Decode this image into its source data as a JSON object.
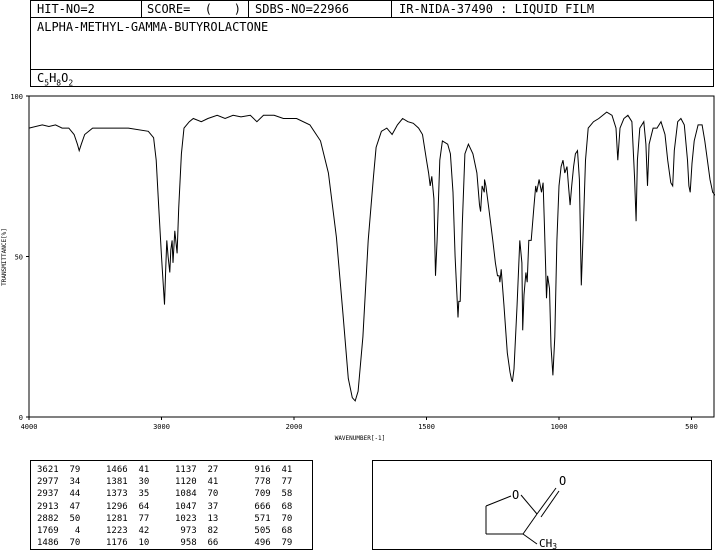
{
  "header": {
    "hit_no": "HIT-NO=2",
    "score": "SCORE=  (   )",
    "sdbs_no": "SDBS-NO=22966",
    "ir_info": "IR-NIDA-37490 : LIQUID FILM",
    "compound_name": "ALPHA-METHYL-GAMMA-BUTYROLACTONE",
    "formula": {
      "c": "C",
      "c_n": "5",
      "h": "H",
      "h_n": "8",
      "o": "O",
      "o_n": "2"
    }
  },
  "chart_data": {
    "type": "line",
    "xlabel": "WAVENUMBER[-1]",
    "ylabel": "TRANSMITTANCE[%]",
    "xlim": [
      4000,
      400
    ],
    "ylim": [
      0,
      100
    ],
    "x_ticks": [
      4000,
      3000,
      2000,
      1500,
      1000,
      500
    ],
    "x_tick_labels": [
      "4000",
      "3000",
      "2000",
      "1500",
      "1000",
      "500"
    ],
    "y_ticks": [
      0,
      50,
      100
    ],
    "y_tick_labels": [
      "0",
      "50",
      "100"
    ],
    "grid": false,
    "series": [
      {
        "points": [
          [
            4000,
            90
          ],
          [
            3900,
            91
          ],
          [
            3850,
            90.5
          ],
          [
            3800,
            91
          ],
          [
            3750,
            90
          ],
          [
            3700,
            90
          ],
          [
            3660,
            88
          ],
          [
            3635,
            85
          ],
          [
            3621,
            83
          ],
          [
            3605,
            85
          ],
          [
            3580,
            88
          ],
          [
            3520,
            90
          ],
          [
            3400,
            90
          ],
          [
            3250,
            90
          ],
          [
            3100,
            89
          ],
          [
            3060,
            87
          ],
          [
            3040,
            80
          ],
          [
            3020,
            65
          ],
          [
            3000,
            50
          ],
          [
            2985,
            40
          ],
          [
            2977,
            35
          ],
          [
            2968,
            46
          ],
          [
            2960,
            55
          ],
          [
            2950,
            50
          ],
          [
            2937,
            45
          ],
          [
            2930,
            52
          ],
          [
            2920,
            55
          ],
          [
            2913,
            48
          ],
          [
            2900,
            58
          ],
          [
            2882,
            51
          ],
          [
            2870,
            65
          ],
          [
            2850,
            82
          ],
          [
            2830,
            90
          ],
          [
            2790,
            92
          ],
          [
            2760,
            93
          ],
          [
            2700,
            92
          ],
          [
            2650,
            93
          ],
          [
            2580,
            94
          ],
          [
            2520,
            93
          ],
          [
            2460,
            94
          ],
          [
            2400,
            93.5
          ],
          [
            2330,
            94
          ],
          [
            2280,
            92
          ],
          [
            2230,
            94
          ],
          [
            2150,
            94
          ],
          [
            2080,
            93
          ],
          [
            2030,
            93
          ],
          [
            1990,
            93
          ],
          [
            1940,
            91
          ],
          [
            1900,
            86
          ],
          [
            1870,
            76
          ],
          [
            1840,
            56
          ],
          [
            1815,
            32
          ],
          [
            1795,
            12
          ],
          [
            1780,
            6
          ],
          [
            1769,
            5
          ],
          [
            1758,
            8
          ],
          [
            1740,
            25
          ],
          [
            1720,
            55
          ],
          [
            1700,
            75
          ],
          [
            1690,
            84
          ],
          [
            1670,
            89
          ],
          [
            1650,
            90
          ],
          [
            1630,
            88
          ],
          [
            1610,
            91
          ],
          [
            1590,
            93
          ],
          [
            1570,
            92
          ],
          [
            1550,
            91.5
          ],
          [
            1530,
            90
          ],
          [
            1515,
            88
          ],
          [
            1500,
            80
          ],
          [
            1492,
            76
          ],
          [
            1486,
            72
          ],
          [
            1480,
            75
          ],
          [
            1472,
            68
          ],
          [
            1466,
            44
          ],
          [
            1460,
            55
          ],
          [
            1450,
            80
          ],
          [
            1440,
            86
          ],
          [
            1420,
            85
          ],
          [
            1410,
            82
          ],
          [
            1400,
            70
          ],
          [
            1392,
            50
          ],
          [
            1381,
            31
          ],
          [
            1378,
            36
          ],
          [
            1373,
            36
          ],
          [
            1365,
            60
          ],
          [
            1355,
            82
          ],
          [
            1342,
            85
          ],
          [
            1325,
            82
          ],
          [
            1310,
            76
          ],
          [
            1300,
            66
          ],
          [
            1296,
            64
          ],
          [
            1290,
            72
          ],
          [
            1282,
            70
          ],
          [
            1281,
            74
          ],
          [
            1276,
            72
          ],
          [
            1265,
            65
          ],
          [
            1250,
            55
          ],
          [
            1240,
            48
          ],
          [
            1232,
            44
          ],
          [
            1226,
            44
          ],
          [
            1223,
            42
          ],
          [
            1218,
            46
          ],
          [
            1208,
            35
          ],
          [
            1195,
            20
          ],
          [
            1185,
            14
          ],
          [
            1180,
            12
          ],
          [
            1176,
            11
          ],
          [
            1170,
            15
          ],
          [
            1158,
            35
          ],
          [
            1148,
            55
          ],
          [
            1140,
            48
          ],
          [
            1137,
            27
          ],
          [
            1132,
            38
          ],
          [
            1125,
            45
          ],
          [
            1120,
            42
          ],
          [
            1114,
            55
          ],
          [
            1105,
            55
          ],
          [
            1095,
            65
          ],
          [
            1088,
            72
          ],
          [
            1084,
            70
          ],
          [
            1075,
            74
          ],
          [
            1066,
            70
          ],
          [
            1060,
            73
          ],
          [
            1055,
            60
          ],
          [
            1050,
            45
          ],
          [
            1047,
            37
          ],
          [
            1043,
            44
          ],
          [
            1036,
            40
          ],
          [
            1030,
            22
          ],
          [
            1023,
            13
          ],
          [
            1016,
            25
          ],
          [
            1008,
            55
          ],
          [
            1000,
            72
          ],
          [
            992,
            78
          ],
          [
            985,
            80
          ],
          [
            978,
            76
          ],
          [
            970,
            78
          ],
          [
            964,
            72
          ],
          [
            958,
            66
          ],
          [
            952,
            72
          ],
          [
            945,
            78
          ],
          [
            938,
            82
          ],
          [
            930,
            83
          ],
          [
            923,
            74
          ],
          [
            916,
            41
          ],
          [
            910,
            55
          ],
          [
            900,
            80
          ],
          [
            890,
            90
          ],
          [
            870,
            92
          ],
          [
            850,
            93
          ],
          [
            820,
            95
          ],
          [
            800,
            94
          ],
          [
            785,
            90
          ],
          [
            778,
            80
          ],
          [
            770,
            90
          ],
          [
            755,
            93
          ],
          [
            740,
            94
          ],
          [
            725,
            92
          ],
          [
            715,
            75
          ],
          [
            709,
            61
          ],
          [
            704,
            80
          ],
          [
            695,
            90
          ],
          [
            680,
            92
          ],
          [
            672,
            85
          ],
          [
            666,
            72
          ],
          [
            660,
            85
          ],
          [
            645,
            90
          ],
          [
            630,
            90
          ],
          [
            615,
            92
          ],
          [
            600,
            88
          ],
          [
            590,
            80
          ],
          [
            578,
            73
          ],
          [
            571,
            72
          ],
          [
            565,
            83
          ],
          [
            552,
            92
          ],
          [
            540,
            93
          ],
          [
            527,
            91
          ],
          [
            515,
            80
          ],
          [
            510,
            72
          ],
          [
            505,
            70
          ],
          [
            498,
            79
          ],
          [
            490,
            86
          ],
          [
            475,
            91
          ],
          [
            460,
            91
          ],
          [
            450,
            86
          ],
          [
            440,
            80
          ],
          [
            430,
            74
          ],
          [
            420,
            70
          ],
          [
            410,
            69
          ],
          [
            400,
            68
          ]
        ]
      }
    ]
  },
  "peak_table": {
    "columns": [
      [
        [
          "3621",
          "79"
        ],
        [
          "2977",
          "34"
        ],
        [
          "2937",
          "44"
        ],
        [
          "2913",
          "47"
        ],
        [
          "2882",
          "50"
        ],
        [
          "1769",
          "4"
        ],
        [
          "1486",
          "70"
        ]
      ],
      [
        [
          "1466",
          "41"
        ],
        [
          "1381",
          "30"
        ],
        [
          "1373",
          "35"
        ],
        [
          "1296",
          "64"
        ],
        [
          "1281",
          "77"
        ],
        [
          "1223",
          "42"
        ],
        [
          "1176",
          "10"
        ]
      ],
      [
        [
          "1137",
          "27"
        ],
        [
          "1120",
          "41"
        ],
        [
          "1084",
          "70"
        ],
        [
          "1047",
          "37"
        ],
        [
          "1023",
          "13"
        ],
        [
          "973",
          "82"
        ],
        [
          "958",
          "66"
        ]
      ],
      [
        [
          "916",
          "41"
        ],
        [
          "778",
          "77"
        ],
        [
          "709",
          "58"
        ],
        [
          "666",
          "68"
        ],
        [
          "571",
          "70"
        ],
        [
          "505",
          "68"
        ],
        [
          "496",
          "79"
        ]
      ]
    ]
  },
  "structure": {
    "o_ring_label": "O",
    "o_carbonyl_label": "O",
    "methyl_label": "CH",
    "methyl_sub": "3"
  }
}
